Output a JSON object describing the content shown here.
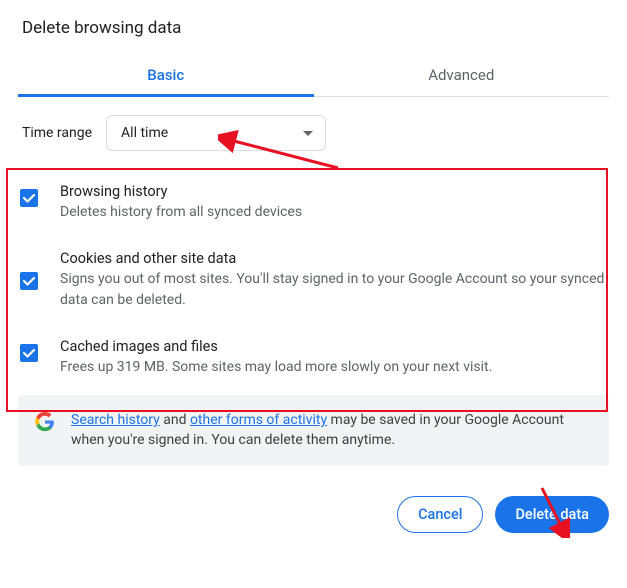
{
  "title": "Delete browsing data",
  "tabs": {
    "basic": "Basic",
    "advanced": "Advanced"
  },
  "time": {
    "label": "Time range",
    "value": "All time"
  },
  "options": {
    "history": {
      "title": "Browsing history",
      "desc": "Deletes history from all synced devices"
    },
    "cookies": {
      "title": "Cookies and other site data",
      "desc": "Signs you out of most sites. You'll stay signed in to your Google Account so your synced data can be deleted."
    },
    "cache": {
      "title": "Cached images and files",
      "desc": "Frees up 319 MB. Some sites may load more slowly on your next visit."
    }
  },
  "info": {
    "link1": "Search history",
    "mid1": " and ",
    "link2": "other forms of activity",
    "rest": " may be saved in your Google Account when you're signed in. You can delete them anytime."
  },
  "actions": {
    "cancel": "Cancel",
    "delete": "Delete data"
  }
}
